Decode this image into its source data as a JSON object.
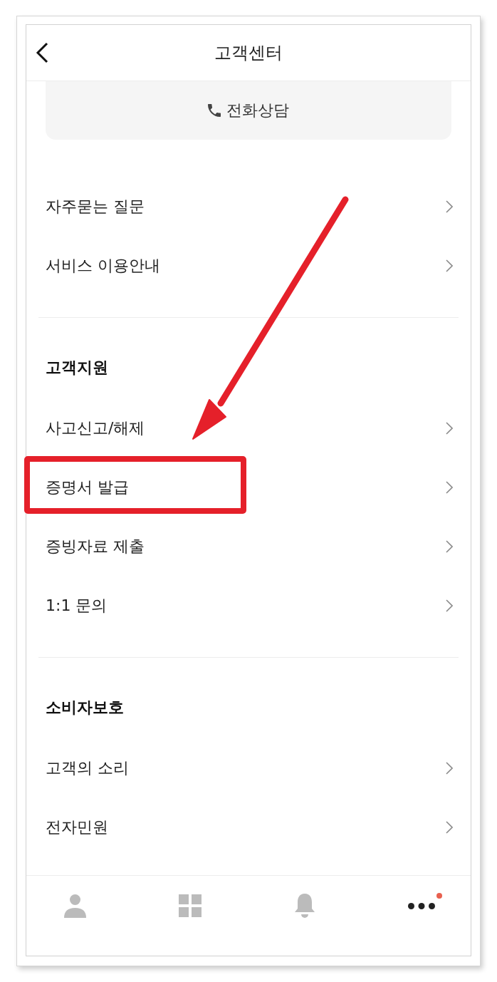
{
  "header": {
    "title": "고객센터"
  },
  "phone_consult": {
    "label": "전화상담"
  },
  "sections": [
    {
      "items": [
        {
          "label": "자주묻는 질문",
          "highlighted": false
        },
        {
          "label": "서비스 이용안내",
          "highlighted": false
        }
      ]
    },
    {
      "heading": "고객지원",
      "items": [
        {
          "label": "사고신고/해제",
          "highlighted": false
        },
        {
          "label": "증명서 발급",
          "highlighted": true
        },
        {
          "label": "증빙자료 제출",
          "highlighted": false
        },
        {
          "label": "1:1 문의",
          "highlighted": false
        }
      ]
    },
    {
      "heading": "소비자보호",
      "items": [
        {
          "label": "고객의 소리",
          "highlighted": false
        },
        {
          "label": "전자민원",
          "highlighted": false
        }
      ]
    }
  ],
  "bottom_nav": [
    {
      "kind": "profile",
      "selected": false,
      "badge": false
    },
    {
      "kind": "menu",
      "selected": false,
      "badge": false
    },
    {
      "kind": "notifications",
      "selected": false,
      "badge": false
    },
    {
      "kind": "more",
      "selected": true,
      "badge": true
    }
  ]
}
